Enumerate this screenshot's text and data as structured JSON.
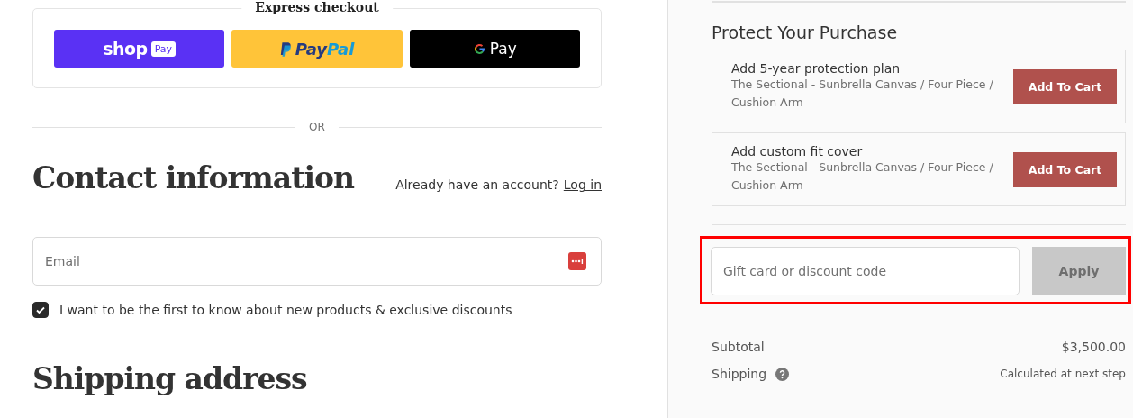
{
  "express_checkout": {
    "title": "Express checkout",
    "buttons": [
      {
        "kind": "shop",
        "label": "shop",
        "badge": "Pay"
      },
      {
        "kind": "paypal",
        "label": "Pay",
        "label_2": "Pal"
      },
      {
        "kind": "gpay",
        "label": "Pay"
      }
    ]
  },
  "divider_text": "OR",
  "contact": {
    "heading": "Contact information",
    "account_prompt": "Already have an account?",
    "login_link": "Log in",
    "email": {
      "placeholder": "Email"
    },
    "newsletter": {
      "label": "I want to be the first to know about new products & exclusive discounts",
      "checked": true
    }
  },
  "shipping": {
    "heading": "Shipping address"
  },
  "protect": {
    "heading": "Protect Your Purchase",
    "offers": [
      {
        "title": "Add 5-year protection plan",
        "detail": "The Sectional - Sunbrella Canvas / Four Piece / Cushion Arm",
        "button": "Add To Cart"
      },
      {
        "title": "Add custom fit cover",
        "detail": "The Sectional - Sunbrella Canvas / Four Piece / Cushion Arm",
        "button": "Add To Cart"
      }
    ]
  },
  "discount": {
    "placeholder": "Gift card or discount code",
    "button": "Apply",
    "disabled": true,
    "highlighted": true
  },
  "summary": [
    {
      "kind": "plain",
      "label": "Subtotal",
      "value": "$3,500.00"
    },
    {
      "kind": "help",
      "label": "Shipping",
      "value": "Calculated at next step"
    }
  ]
}
